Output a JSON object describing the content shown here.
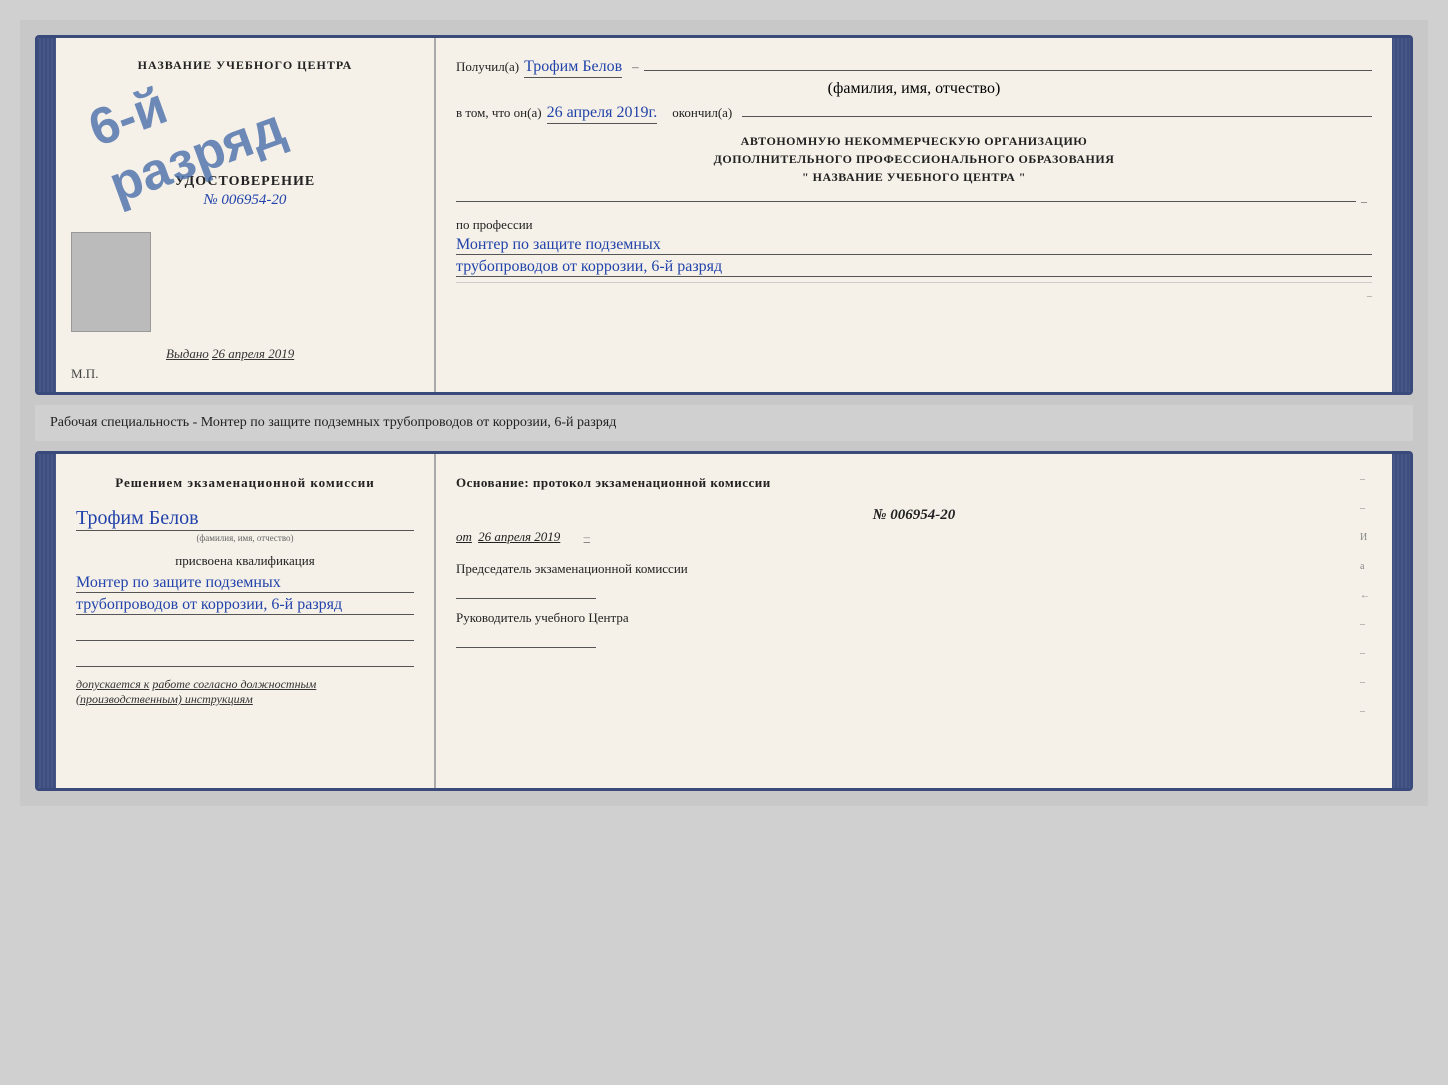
{
  "top_doc": {
    "left": {
      "title": "НАЗВАНИЕ УЧЕБНОГО ЦЕНТРА",
      "stamp_text": "6-й разряд",
      "cert_label": "УДОСТОВЕРЕНИЕ",
      "cert_number_prefix": "№",
      "cert_number": "006954-20",
      "issued_label": "Выдано",
      "issued_date": "26 апреля 2019",
      "mp_label": "М.П."
    },
    "right": {
      "received_label": "Получил(а)",
      "person_name": "Трофим Белов",
      "name_hint": "(фамилия, имя, отчество)",
      "confirm_label": "в том, что он(а)",
      "confirm_date": "26 апреля 2019г.",
      "completed_label": "окончил(а)",
      "org_line1": "АВТОНОМНУЮ НЕКОММЕРЧЕСКУЮ ОРГАНИЗАЦИЮ",
      "org_line2": "ДОПОЛНИТЕЛЬНОГО ПРОФЕССИОНАЛЬНОГО ОБРАЗОВАНИЯ",
      "org_name": "\"  НАЗВАНИЕ УЧЕБНОГО ЦЕНТРА  \"",
      "profession_label": "по профессии",
      "profession_line1": "Монтер по защите подземных",
      "profession_line2": "трубопроводов от коррозии, 6-й разряд"
    }
  },
  "middle_text": "Рабочая специальность - Монтер по защите подземных трубопроводов от коррозии, 6-й разряд",
  "bottom_doc": {
    "left": {
      "title": "Решением экзаменационной комиссии",
      "person_name": "Трофим Белов",
      "name_hint": "(фамилия, имя, отчество)",
      "assigned_label": "присвоена квалификация",
      "qualification_line1": "Монтер по защите подземных",
      "qualification_line2": "трубопроводов от коррозии, 6-й разряд",
      "allowed_prefix": "допускается к",
      "allowed_text": "работе согласно должностным (производственным) инструкциям"
    },
    "right": {
      "basis_title": "Основание: протокол экзаменационной комиссии",
      "protocol_number": "№  006954-20",
      "date_prefix": "от",
      "date": "26 апреля 2019",
      "chairman_label": "Председатель экзаменационной комиссии",
      "director_label": "Руководитель учебного Центра"
    }
  }
}
